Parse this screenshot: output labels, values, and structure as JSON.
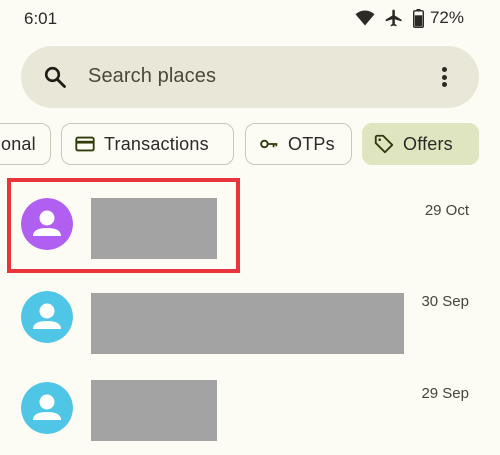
{
  "status_bar": {
    "time": "6:01",
    "battery_percent": "72%",
    "icons": [
      "wifi-icon",
      "airplane-mode-icon",
      "battery-icon"
    ]
  },
  "search": {
    "placeholder": "Search places",
    "icon": "search-icon",
    "menu_icon": "more-vert-icon"
  },
  "chips": [
    {
      "label": "onal",
      "icon": null,
      "selected": false
    },
    {
      "label": "Transactions",
      "icon": "credit-card-icon",
      "selected": false
    },
    {
      "label": "OTPs",
      "icon": "key-icon",
      "selected": false
    },
    {
      "label": "Offers",
      "icon": "tag-icon",
      "selected": true
    }
  ],
  "messages": [
    {
      "date": "29 Oct",
      "avatar_color": "#b05ff0",
      "sender": "redacted",
      "highlighted": true
    },
    {
      "date": "30 Sep",
      "avatar_color": "#4fc6e5",
      "sender": "redacted",
      "highlighted": false
    },
    {
      "date": "29 Sep",
      "avatar_color": "#4fc6e5",
      "sender": "redacted",
      "highlighted": false
    }
  ],
  "colors": {
    "background": "#fdfcf4",
    "search_bar": "#e9e8d8",
    "selected_chip": "#dfe5c1",
    "redaction": "#a3a3a3",
    "highlight": "#e8343a"
  }
}
